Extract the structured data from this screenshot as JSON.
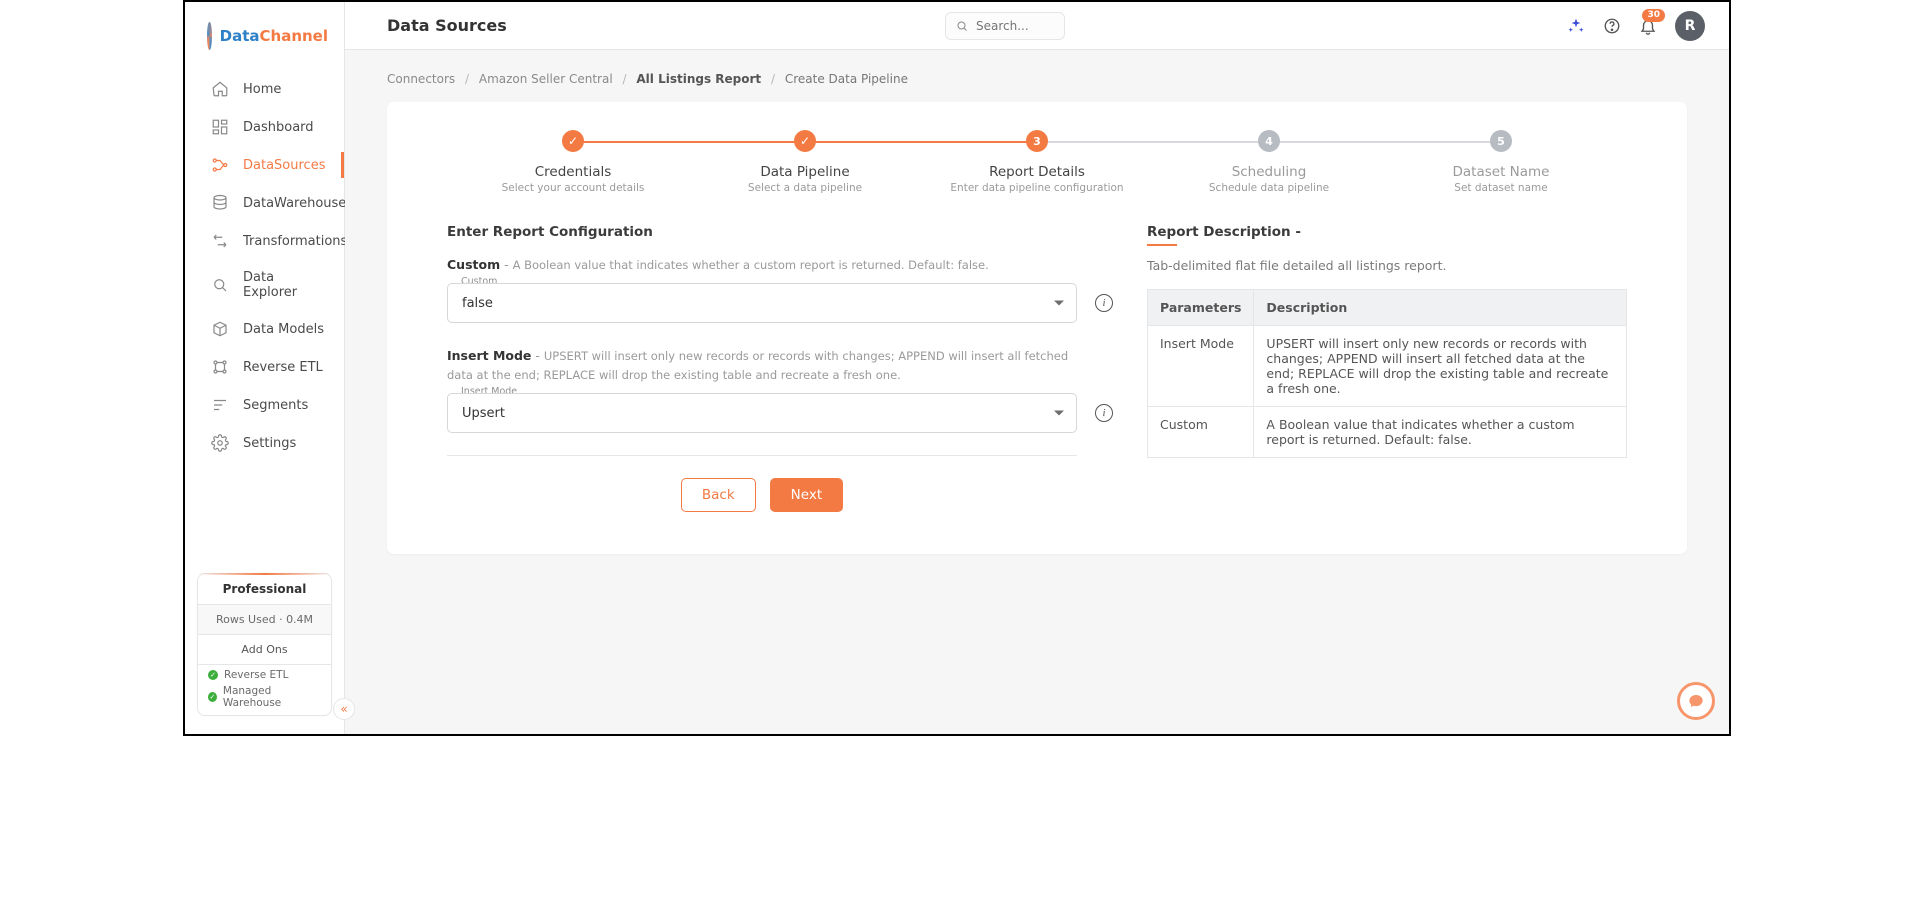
{
  "brand": {
    "part1": "Data",
    "part2": "Channel"
  },
  "header": {
    "title": "Data Sources",
    "search_placeholder": "Search...",
    "badge": "30",
    "avatar": "R"
  },
  "sidebar": {
    "items": [
      {
        "label": "Home"
      },
      {
        "label": "Dashboard"
      },
      {
        "label": "DataSources"
      },
      {
        "label": "DataWarehouses"
      },
      {
        "label": "Transformations"
      },
      {
        "label": "Data Explorer"
      },
      {
        "label": "Data Models"
      },
      {
        "label": "Reverse ETL"
      },
      {
        "label": "Segments"
      },
      {
        "label": "Settings"
      }
    ],
    "plan": {
      "tier": "Professional",
      "rows_used": "Rows Used · 0.4M",
      "addons_title": "Add Ons",
      "addons": [
        "Reverse ETL",
        "Managed Warehouse"
      ]
    }
  },
  "breadcrumb": {
    "a": "Connectors",
    "b": "Amazon Seller Central",
    "c": "All Listings Report",
    "d": "Create Data Pipeline"
  },
  "stepper": [
    {
      "label": "Credentials",
      "sub": "Select your account details",
      "state": "done"
    },
    {
      "label": "Data Pipeline",
      "sub": "Select a data pipeline",
      "state": "done"
    },
    {
      "label": "Report Details",
      "sub": "Enter data pipeline configuration",
      "state": "active",
      "num": "3"
    },
    {
      "label": "Scheduling",
      "sub": "Schedule data pipeline",
      "state": "upcoming",
      "num": "4"
    },
    {
      "label": "Dataset Name",
      "sub": "Set dataset name",
      "state": "upcoming",
      "num": "5"
    }
  ],
  "form": {
    "heading": "Enter Report Configuration",
    "custom": {
      "name": "Custom",
      "hint": "A Boolean value that indicates whether a custom report is returned. Default: false.",
      "float": "Custom",
      "value": "false"
    },
    "insert": {
      "name": "Insert Mode",
      "hint": "UPSERT will insert only new records or records with changes; APPEND will insert all fetched data at the end; REPLACE will drop the existing table and recreate a fresh one.",
      "float": "Insert Mode",
      "value": "Upsert"
    },
    "back": "Back",
    "next": "Next"
  },
  "desc": {
    "heading": "Report Description -",
    "text": "Tab-delimited flat file detailed all listings report.",
    "th1": "Parameters",
    "th2": "Description",
    "rows": [
      {
        "p": "Insert Mode",
        "d": "UPSERT will insert only new records or records with changes; APPEND will insert all fetched data at the end; REPLACE will drop the existing table and recreate a fresh one."
      },
      {
        "p": "Custom",
        "d": "A Boolean value that indicates whether a custom report is returned. Default: false."
      }
    ]
  }
}
